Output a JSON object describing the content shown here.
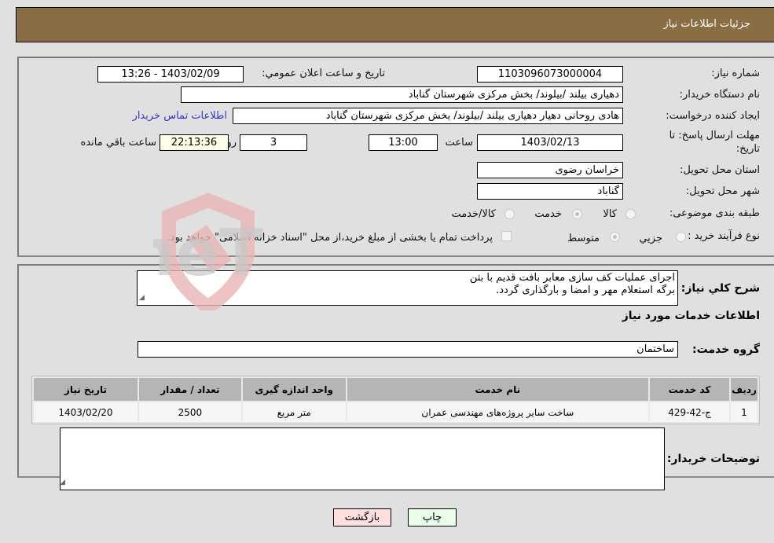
{
  "header": {
    "title": "جزئیات اطلاعات نیاز"
  },
  "form": {
    "need_number": {
      "label": "شماره نیاز:",
      "value": "1103096073000004"
    },
    "announce_datetime": {
      "label": "تاریخ و ساعت اعلان عمومي:",
      "value": "1403/02/09 - 13:26"
    },
    "buyer_org": {
      "label": "نام دستگاه خريدار:",
      "value": "دهیاری بیلند /بیلوند/ بخش مرکزی شهرستان گناباد"
    },
    "requester": {
      "label": "ايجاد کننده درخواست:",
      "value": "هادی روحانی دهیار دهیاری بیلند /بیلوند/ بخش مرکزی شهرستان گناباد"
    },
    "buyer_contact_link": "اطلاعات تماس خريدار",
    "deadline": {
      "label": "مهلت ارسال پاسخ: تا تاريخ:",
      "date": "1403/02/13",
      "time_label": "ساعت",
      "time": "13:00",
      "days": "3",
      "days_label": "روز و",
      "remaining": "22:13:36",
      "remaining_label": "ساعت باقي مانده"
    },
    "province": {
      "label": "استان محل تحويل:",
      "value": "خراسان رضوی"
    },
    "city": {
      "label": "شهر محل تحويل:",
      "value": "گناباد"
    },
    "category": {
      "label": "طبقه بندی موضوعی:",
      "options": [
        {
          "label": "کالا",
          "selected": false
        },
        {
          "label": "خدمت",
          "selected": true
        },
        {
          "label": "کالا/خدمت",
          "selected": false
        }
      ]
    },
    "purchase_type": {
      "label": "نوع فرآيند خريد :",
      "options": [
        {
          "label": "جزيي",
          "selected": false
        },
        {
          "label": "متوسط",
          "selected": true
        }
      ],
      "treasury_checkbox_label": "پرداخت تمام يا بخشی از مبلغ خريد،از محل \"اسناد خزانه اسلامی\" خواهد بود.",
      "treasury_checked": false
    }
  },
  "details": {
    "description_label": "شرح کلي نياز:",
    "description_lines": [
      "اجرای عملیات کف سازی معابر بافت قدیم با بتن",
      "برگه استعلام مهر و امضا و بارگذاری گردد."
    ],
    "services_heading": "اطلاعات خدمات مورد نياز",
    "service_group_label": "گروه خدمت:",
    "service_group_value": "ساختمان",
    "table": {
      "headers": [
        "رديف",
        "کد خدمت",
        "نام خدمت",
        "واحد اندازه گيری",
        "تعداد / مقدار",
        "تاريخ نياز"
      ],
      "rows": [
        [
          "1",
          "ج-42-429",
          "ساخت سایر پروژه‌های مهندسی عمران",
          "متر مربع",
          "2500",
          "1403/02/20"
        ]
      ]
    },
    "buyer_notes_label": "توضيحات خريدار:",
    "buyer_notes_value": ""
  },
  "buttons": {
    "print": "چاپ",
    "back": "بازگشت"
  },
  "watermark": {
    "text": "AriaTender.neT"
  },
  "colors": {
    "header_bg": "#8b6d43",
    "link": "#3333cc",
    "back_btn": "#ffdede",
    "print_btn": "#eaffea",
    "remaining_bg": "#ffffe6"
  }
}
